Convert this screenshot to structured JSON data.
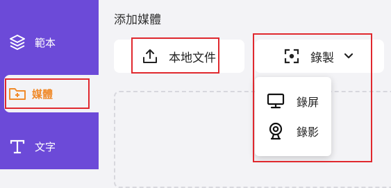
{
  "sidebar": {
    "items": [
      {
        "label": "範本",
        "icon": "layers-icon"
      },
      {
        "label": "媒體",
        "icon": "folder-plus-icon",
        "active": true
      },
      {
        "label": "文字",
        "icon": "text-t-icon"
      }
    ]
  },
  "main": {
    "section_title": "添加媒體",
    "upload_button": {
      "label": "本地文件",
      "icon": "upload-icon"
    },
    "record_button": {
      "label": "錄製",
      "icon": "record-focus-icon"
    },
    "record_menu": {
      "items": [
        {
          "label": "錄屏",
          "icon": "monitor-icon"
        },
        {
          "label": "錄影",
          "icon": "webcam-icon"
        }
      ]
    }
  },
  "colors": {
    "sidebar": "#6c4ad8",
    "active_accent": "#f08a2a",
    "highlight": "#e0282e"
  }
}
